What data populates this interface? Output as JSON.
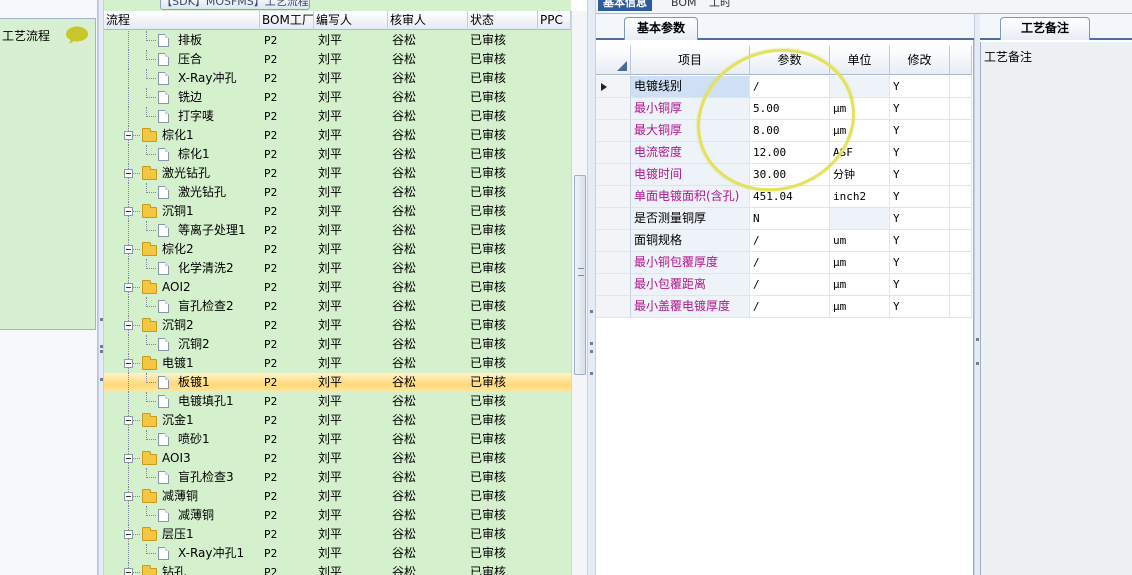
{
  "left_panel": {
    "label": "工艺流程"
  },
  "tree": {
    "window_tab": "【SDK】MOSFMS】工艺流程",
    "columns": [
      "流程",
      "BOM工厂",
      "编写人",
      "核审人",
      "状态",
      "PPC"
    ],
    "rows": [
      {
        "name": "排板",
        "factory": "P2",
        "writer": "刘平",
        "reviewer": "谷松",
        "status": "已审核"
      },
      {
        "name": "压合",
        "factory": "P2",
        "writer": "刘平",
        "reviewer": "谷松",
        "status": "已审核"
      },
      {
        "name": "X-Ray冲孔",
        "factory": "P2",
        "writer": "刘平",
        "reviewer": "谷松",
        "status": "已审核"
      },
      {
        "name": "铣边",
        "factory": "P2",
        "writer": "刘平",
        "reviewer": "谷松",
        "status": "已审核"
      },
      {
        "name": "打字唛",
        "factory": "P2",
        "writer": "刘平",
        "reviewer": "谷松",
        "status": "已审核"
      },
      {
        "name": "棕化1",
        "factory": "P2",
        "writer": "刘平",
        "reviewer": "谷松",
        "status": "已审核"
      },
      {
        "name": "棕化1",
        "factory": "P2",
        "writer": "刘平",
        "reviewer": "谷松",
        "status": "已审核"
      },
      {
        "name": "激光钻孔",
        "factory": "P2",
        "writer": "刘平",
        "reviewer": "谷松",
        "status": "已审核"
      },
      {
        "name": "激光钻孔",
        "factory": "P2",
        "writer": "刘平",
        "reviewer": "谷松",
        "status": "已审核"
      },
      {
        "name": "沉铜1",
        "factory": "P2",
        "writer": "刘平",
        "reviewer": "谷松",
        "status": "已审核"
      },
      {
        "name": "等离子处理1",
        "factory": "P2",
        "writer": "刘平",
        "reviewer": "谷松",
        "status": "已审核"
      },
      {
        "name": "棕化2",
        "factory": "P2",
        "writer": "刘平",
        "reviewer": "谷松",
        "status": "已审核"
      },
      {
        "name": "化学清洗2",
        "factory": "P2",
        "writer": "刘平",
        "reviewer": "谷松",
        "status": "已审核"
      },
      {
        "name": "AOI2",
        "factory": "P2",
        "writer": "刘平",
        "reviewer": "谷松",
        "status": "已审核"
      },
      {
        "name": "盲孔检查2",
        "factory": "P2",
        "writer": "刘平",
        "reviewer": "谷松",
        "status": "已审核"
      },
      {
        "name": "沉铜2",
        "factory": "P2",
        "writer": "刘平",
        "reviewer": "谷松",
        "status": "已审核"
      },
      {
        "name": "沉铜2",
        "factory": "P2",
        "writer": "刘平",
        "reviewer": "谷松",
        "status": "已审核"
      },
      {
        "name": "电镀1",
        "factory": "P2",
        "writer": "刘平",
        "reviewer": "谷松",
        "status": "已审核"
      },
      {
        "name": "板镀1",
        "factory": "P2",
        "writer": "刘平",
        "reviewer": "谷松",
        "status": "已审核"
      },
      {
        "name": "电镀填孔1",
        "factory": "P2",
        "writer": "刘平",
        "reviewer": "谷松",
        "status": "已审核"
      },
      {
        "name": "沉金1",
        "factory": "P2",
        "writer": "刘平",
        "reviewer": "谷松",
        "status": "已审核"
      },
      {
        "name": "喷砂1",
        "factory": "P2",
        "writer": "刘平",
        "reviewer": "谷松",
        "status": "已审核"
      },
      {
        "name": "AOI3",
        "factory": "P2",
        "writer": "刘平",
        "reviewer": "谷松",
        "status": "已审核"
      },
      {
        "name": "盲孔检查3",
        "factory": "P2",
        "writer": "刘平",
        "reviewer": "谷松",
        "status": "已审核"
      },
      {
        "name": "减薄铜",
        "factory": "P2",
        "writer": "刘平",
        "reviewer": "谷松",
        "status": "已审核"
      },
      {
        "name": "减薄铜",
        "factory": "P2",
        "writer": "刘平",
        "reviewer": "谷松",
        "status": "已审核"
      },
      {
        "name": "层压1",
        "factory": "P2",
        "writer": "刘平",
        "reviewer": "谷松",
        "status": "已审核"
      },
      {
        "name": "X-Ray冲孔1",
        "factory": "P2",
        "writer": "刘平",
        "reviewer": "谷松",
        "status": "已审核"
      },
      {
        "name": "钻孔",
        "factory": "P2",
        "writer": "刘平",
        "reviewer": "谷松",
        "status": "已审核"
      }
    ]
  },
  "top_tabs": [
    "基本信息",
    "BOM",
    "工时"
  ],
  "info": {
    "subtab": "基本参数",
    "columns": [
      "项目",
      "参数",
      "单位",
      "修改"
    ],
    "rows": [
      {
        "item": "电镀线别",
        "value": "/",
        "unit": "",
        "edit": "Y"
      },
      {
        "item": "最小铜厚",
        "value": "5.00",
        "unit": "μm",
        "edit": "Y"
      },
      {
        "item": "最大铜厚",
        "value": "8.00",
        "unit": "μm",
        "edit": "Y"
      },
      {
        "item": "电流密度",
        "value": "12.00",
        "unit": "ASF",
        "edit": "Y"
      },
      {
        "item": "电镀时间",
        "value": "30.00",
        "unit": "分钟",
        "edit": "Y"
      },
      {
        "item": "单面电镀面积(含孔)",
        "value": "451.04",
        "unit": "inch2",
        "edit": "Y"
      },
      {
        "item": "是否测量铜厚",
        "value": "N",
        "unit": "",
        "edit": "Y"
      },
      {
        "item": "面铜规格",
        "value": "/",
        "unit": "um",
        "edit": "Y"
      },
      {
        "item": "最小铜包覆厚度",
        "value": "/",
        "unit": "μm",
        "edit": "Y"
      },
      {
        "item": "最小包覆距离",
        "value": "/",
        "unit": "μm",
        "edit": "Y"
      },
      {
        "item": "最小盖覆电镀厚度",
        "value": "/",
        "unit": "μm",
        "edit": "Y"
      }
    ]
  },
  "notes": {
    "tab": "工艺备注",
    "label": "工艺备注"
  },
  "colors": {
    "tree_bg": "#d4f0cc",
    "selection": "#ffd97a",
    "magenta_text": "#b0178a",
    "active_tab": "#2e5b9e",
    "annotation": "#e4e25a"
  }
}
